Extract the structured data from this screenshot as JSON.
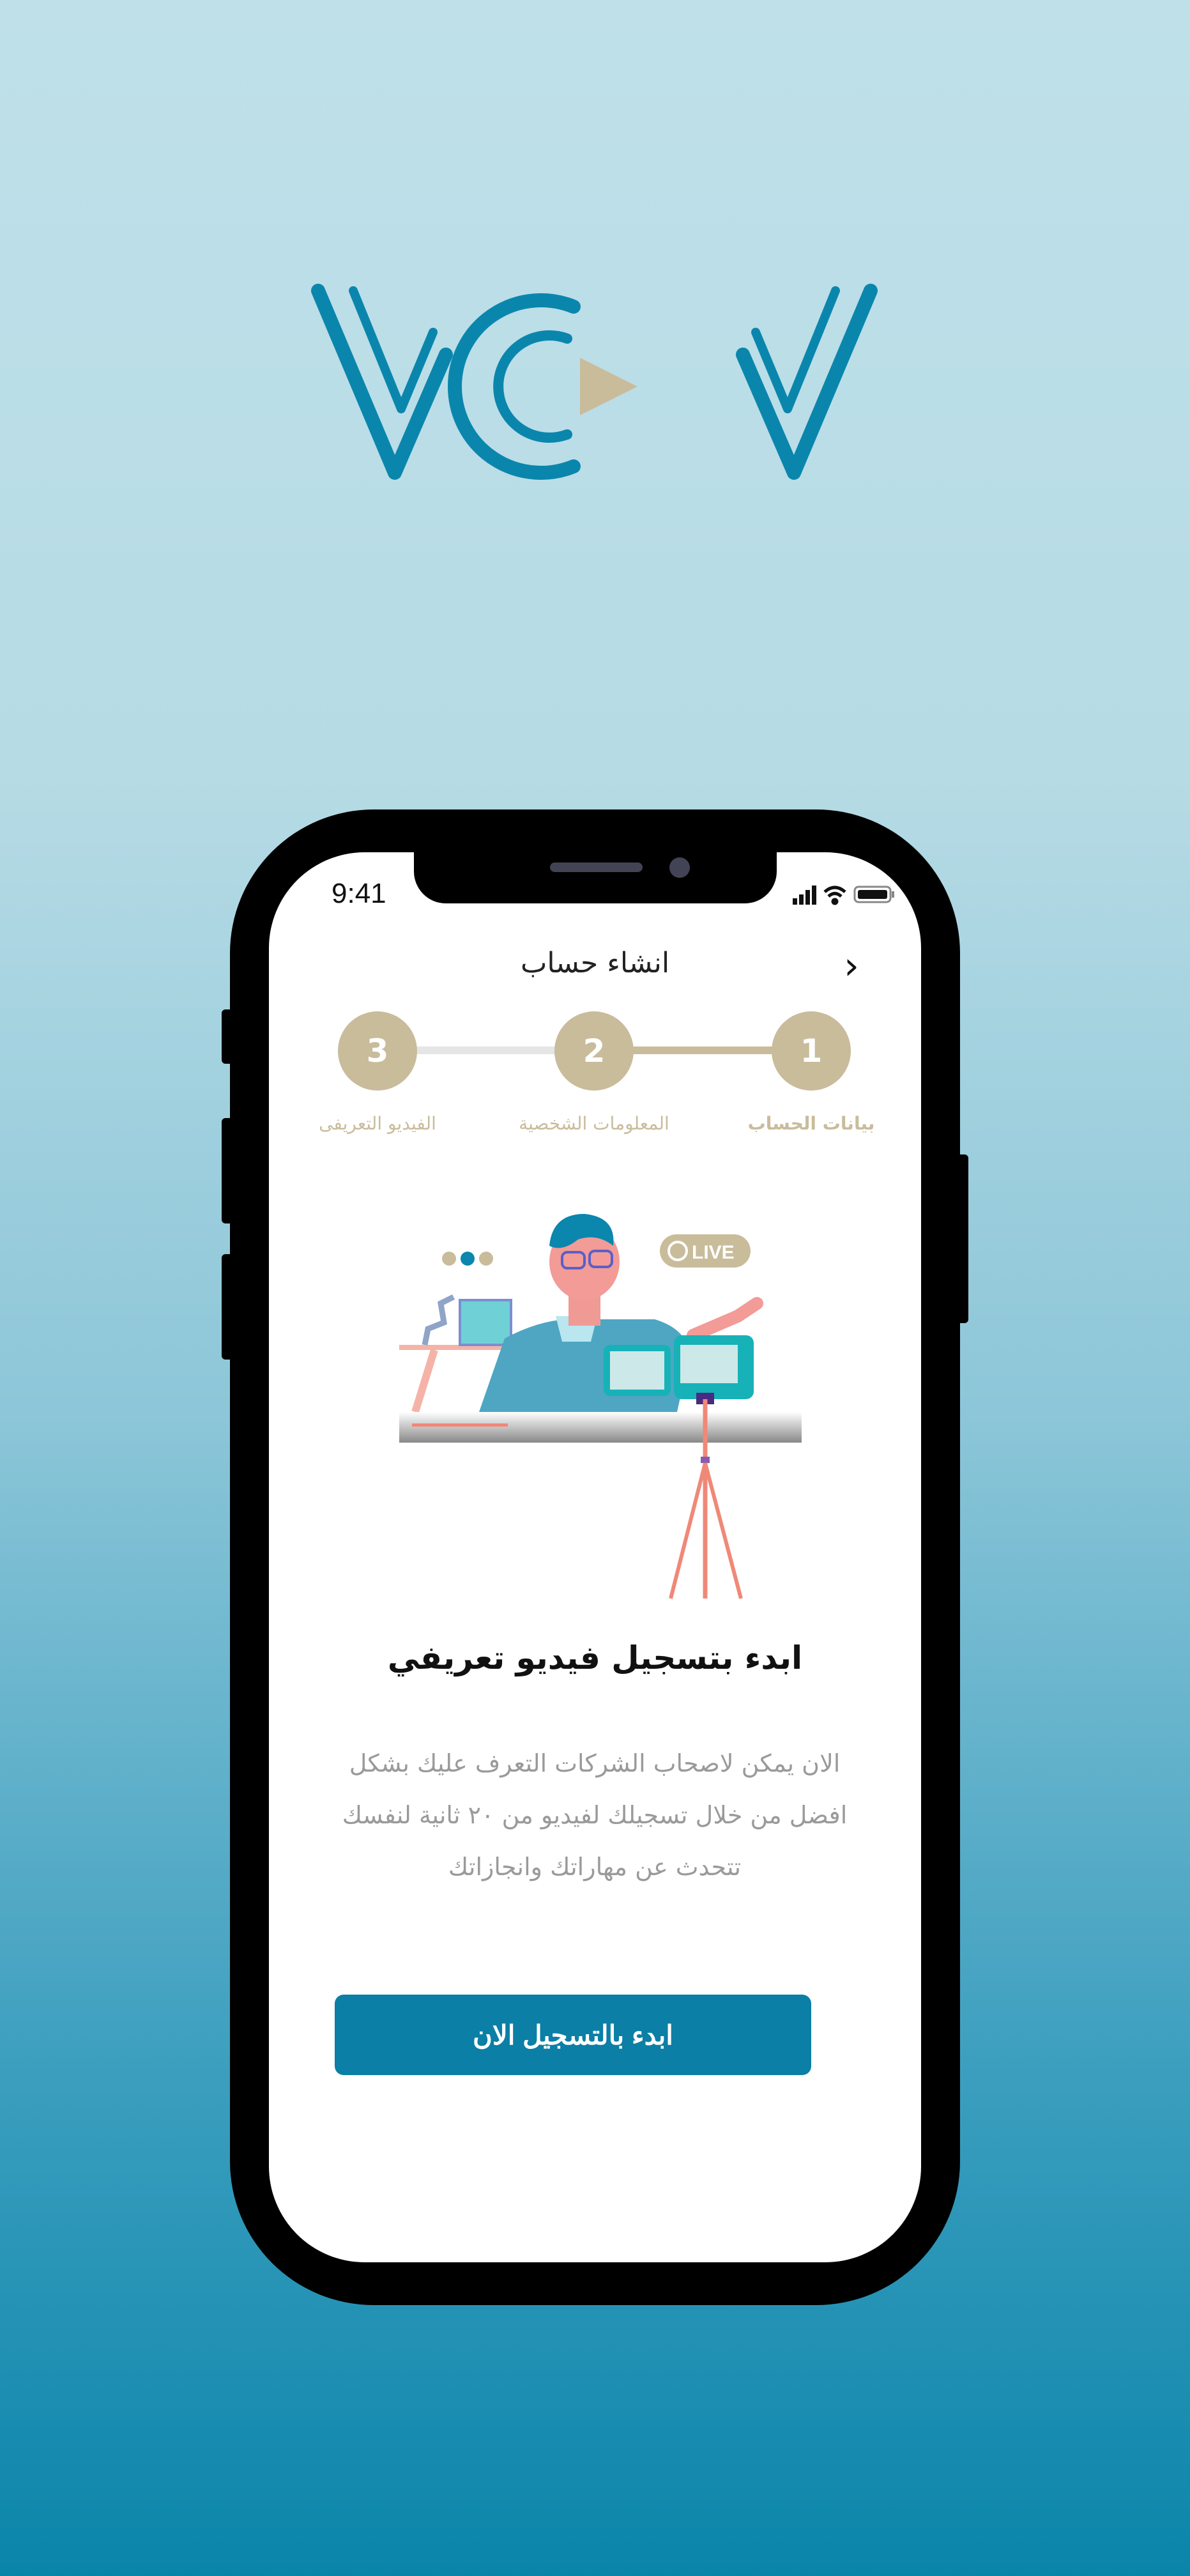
{
  "logo": {
    "text": "VCV",
    "primary_color": "#0a86ad",
    "accent_color": "#c9bc9b"
  },
  "status_bar": {
    "time": "9:41"
  },
  "header": {
    "title": "انشاء حساب",
    "back_icon": "chevron-right-icon"
  },
  "stepper": {
    "current_step": 1,
    "steps": [
      {
        "number": "1",
        "label": "بيانات الحساب"
      },
      {
        "number": "2",
        "label": "المعلومات الشخصية"
      },
      {
        "number": "3",
        "label": "الفيديو التعريفى"
      }
    ]
  },
  "illustration": {
    "badge": "LIVE"
  },
  "content": {
    "heading": "ابدء بتسجيل فيديو تعريفي",
    "lines": [
      "الان يمكن لاصحاب الشركات التعرف عليك بشكل",
      "افضل من خلال تسجيلك لفيديو من ٢٠ ثانية لنفسك",
      "تتحدث عن مهاراتك وانجازاتك"
    ]
  },
  "cta": {
    "label": "ابدء بالتسجيل الان"
  },
  "colors": {
    "accent": "#0b7fa6",
    "step": "#c9bc9b"
  }
}
